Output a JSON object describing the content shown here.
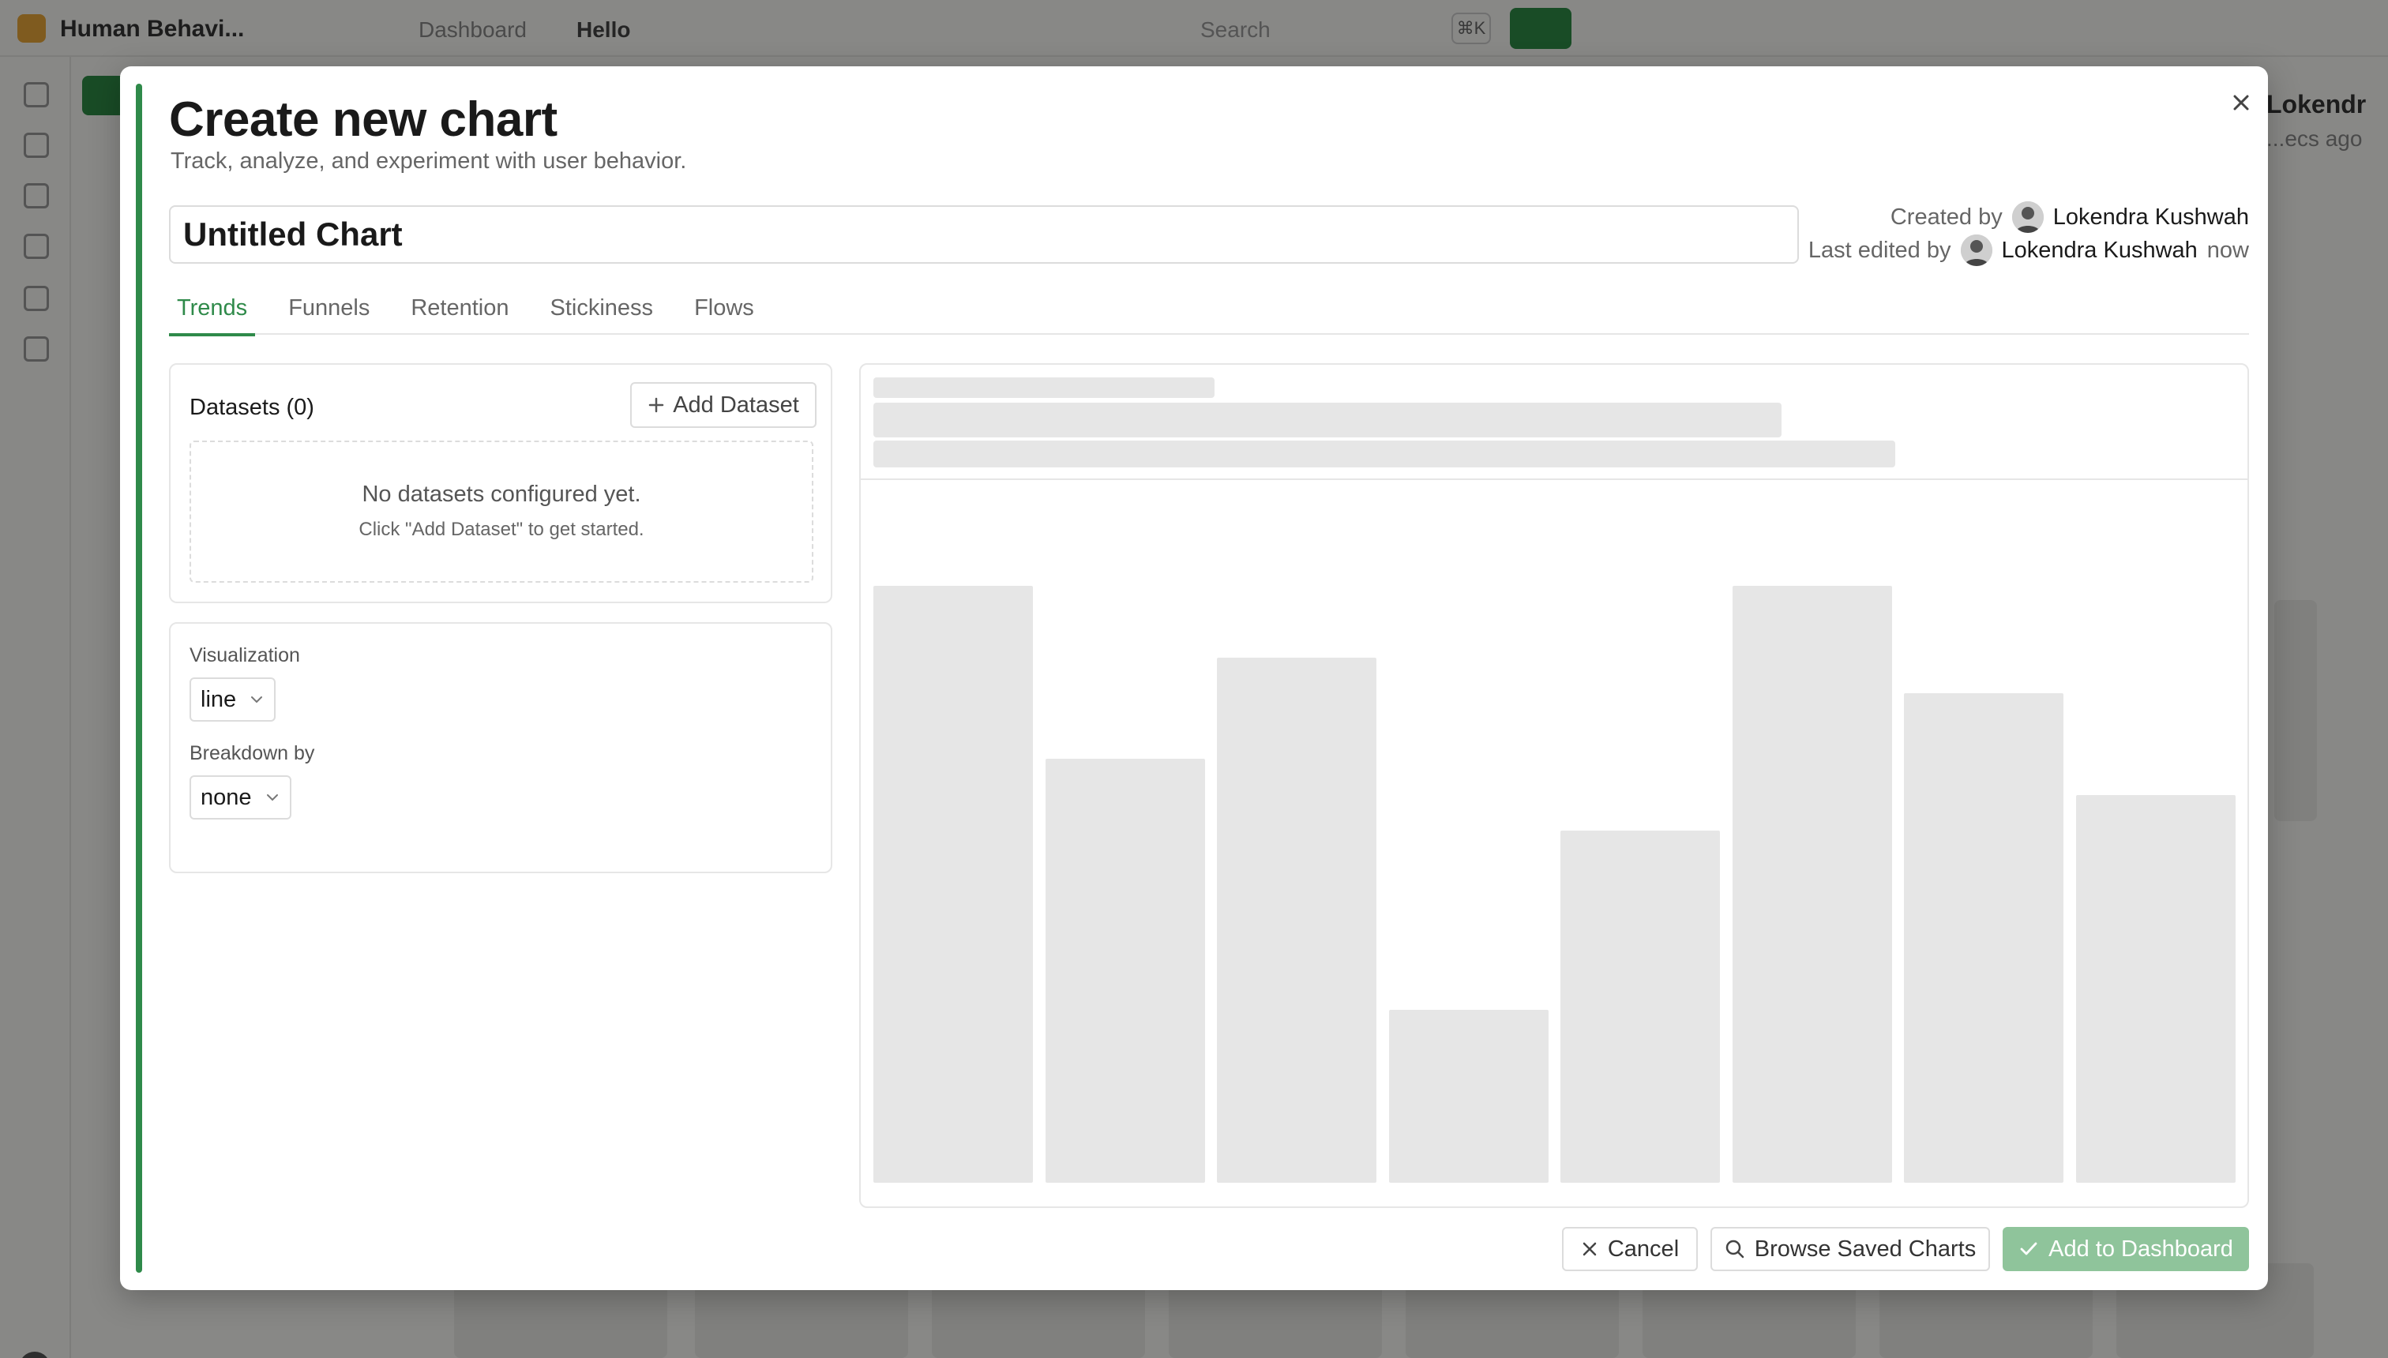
{
  "background": {
    "org_name": "Human Behavi...",
    "breadcrumb": [
      "Dashboard",
      "Hello"
    ],
    "search_placeholder": "Search",
    "search_shortcut": "⌘K",
    "right_name": "Lokendr",
    "right_sub": "...ecs ago"
  },
  "modal": {
    "title": "Create new chart",
    "subtitle": "Track, analyze, and experiment with user behavior.",
    "chart_name": "Untitled Chart",
    "meta": {
      "created_label": "Created by",
      "created_user": "Lokendra Kushwah",
      "edited_label": "Last edited by",
      "edited_user": "Lokendra Kushwah",
      "edited_time": "now"
    },
    "tabs": [
      {
        "label": "Trends",
        "active": true
      },
      {
        "label": "Funnels",
        "active": false
      },
      {
        "label": "Retention",
        "active": false
      },
      {
        "label": "Stickiness",
        "active": false
      },
      {
        "label": "Flows",
        "active": false
      }
    ],
    "datasets": {
      "title": "Datasets (0)",
      "add_label": "Add Dataset",
      "empty_title": "No datasets configured yet.",
      "empty_hint": "Click \"Add Dataset\" to get started."
    },
    "visualization": {
      "label": "Visualization",
      "value": "line"
    },
    "breakdown": {
      "label": "Breakdown by",
      "value": "none"
    },
    "preview": {
      "placeholder_bar_levels": [
        1.0,
        0.71,
        0.88,
        0.29,
        0.59,
        1.0,
        0.82,
        0.65
      ]
    },
    "footer": {
      "cancel": "Cancel",
      "browse": "Browse Saved Charts",
      "add": "Add to Dashboard"
    }
  },
  "colors": {
    "accent": "#2f8a4a",
    "primary_disabled": "#8fc49b",
    "skeleton": "#e6e6e6"
  }
}
